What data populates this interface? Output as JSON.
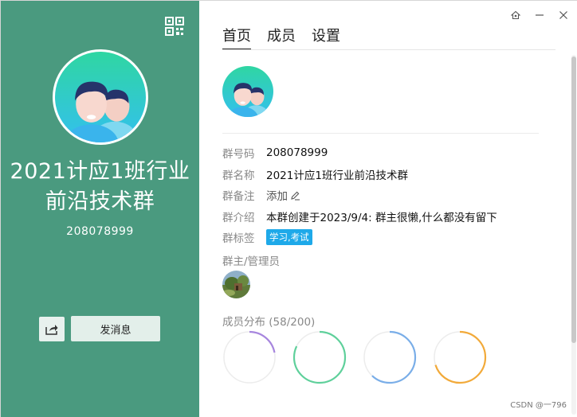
{
  "left": {
    "group_name": "2021计应1班行业前沿技术群",
    "group_id": "208078999",
    "send_label": "发消息",
    "bg_color": "#4a9a7f"
  },
  "tabs": [
    {
      "label": "首页",
      "active": true
    },
    {
      "label": "成员",
      "active": false
    },
    {
      "label": "设置",
      "active": false
    }
  ],
  "info": {
    "rows": [
      {
        "key": "群号码",
        "value": "208078999"
      },
      {
        "key": "群名称",
        "value": "2021计应1班行业前沿技术群"
      },
      {
        "key": "群备注",
        "value": "添加"
      },
      {
        "key": "群介绍",
        "value": "本群创建于2023/9/4:  群主很懒,什么都没有留下"
      },
      {
        "key": "群标签",
        "value": "学习,考试"
      }
    ]
  },
  "admins": {
    "title": "群主/管理员"
  },
  "distribution": {
    "title": "成员分布 (58/200)",
    "rings": [
      {
        "color": "#a786de",
        "fraction": 0.22
      },
      {
        "color": "#5fd09b",
        "fraction": 0.82
      },
      {
        "color": "#7aaee8",
        "fraction": 0.62
      },
      {
        "color": "#f2aa3a",
        "fraction": 0.7
      }
    ]
  },
  "icons": [
    "qr-code-icon",
    "share-icon",
    "skin-icon",
    "minimize-icon",
    "close-icon",
    "edit-icon"
  ],
  "watermark": "CSDN @一796"
}
